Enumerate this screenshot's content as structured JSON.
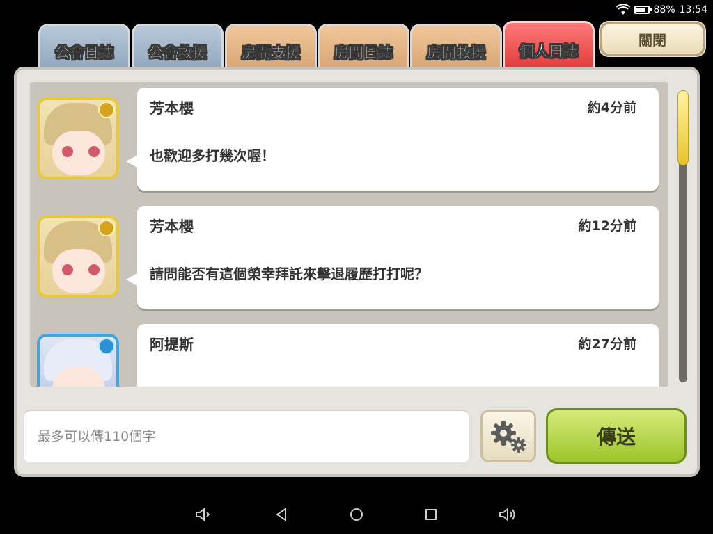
{
  "status_bar": {
    "battery": "88%",
    "time": "13:54",
    "battery_level": 0.88
  },
  "tabs": [
    {
      "label": "公會日誌",
      "active": false
    },
    {
      "label": "公會救援",
      "active": false
    },
    {
      "label": "房間支援",
      "active": false
    },
    {
      "label": "房間日誌",
      "active": false
    },
    {
      "label": "房間救援",
      "active": false
    },
    {
      "label": "個人日誌",
      "active": true
    }
  ],
  "close_button": {
    "label": "關閉"
  },
  "messages": [
    {
      "sender": "芳本櫻",
      "time": "約4分前",
      "text": "也歡迎多打幾次喔！"
    },
    {
      "sender": "芳本櫻",
      "time": "約12分前",
      "text": "請問能否有這個榮幸拜託來擊退履歷打打呢？"
    },
    {
      "sender": "阿提斯",
      "time": "約27分前",
      "text": ""
    }
  ],
  "input": {
    "placeholder": "最多可以傳110個字",
    "value": ""
  },
  "send_button": {
    "label": "傳送"
  },
  "colors": {
    "active_tab": "#e23c3c",
    "send_button": "#9cc52b",
    "panel": "#e6e4de"
  }
}
